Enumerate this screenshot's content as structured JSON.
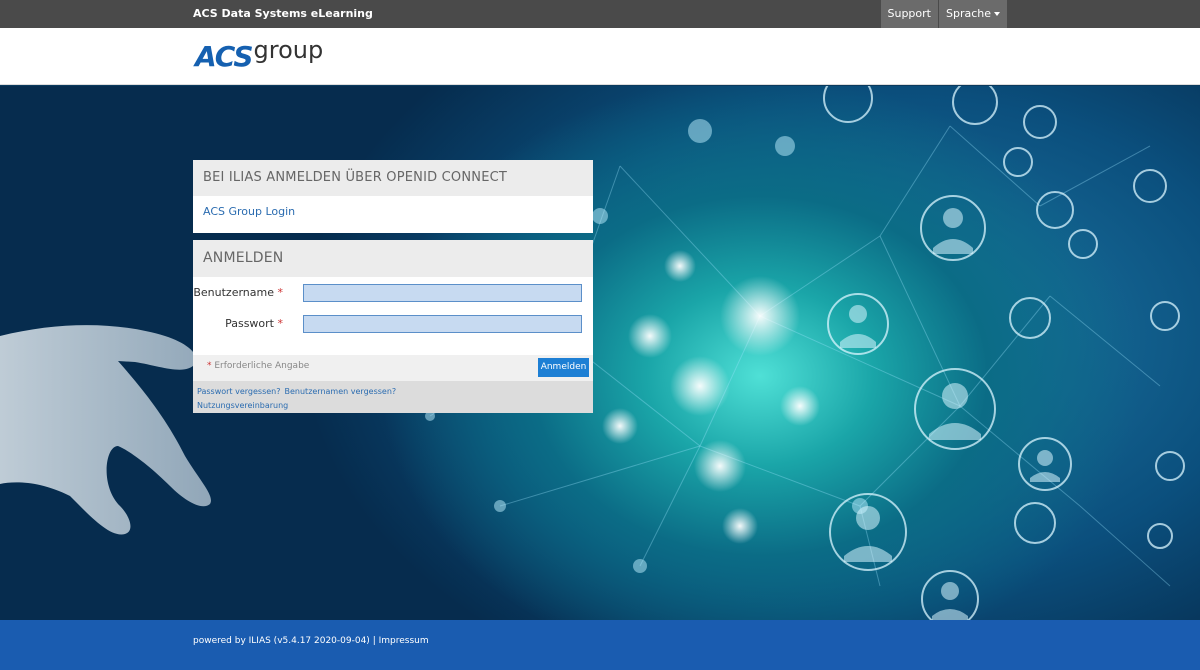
{
  "topbar": {
    "brand": "ACS Data Systems eLearning",
    "support": "Support",
    "language": "Sprache"
  },
  "logo": {
    "acs": "ACS",
    "group": "group"
  },
  "openid": {
    "heading": "BEI ILIAS ANMELDEN ÜBER OPENID CONNECT",
    "link": "ACS Group Login"
  },
  "login": {
    "heading": "ANMELDEN",
    "username_label": "Benutzername",
    "password_label": "Passwort",
    "required_mark": "*",
    "required_note": "Erforderliche Angabe",
    "submit": "Anmelden",
    "forgot_password": "Passwort vergessen?",
    "forgot_username": "Benutzernamen vergessen?",
    "terms": "Nutzungsvereinbarung"
  },
  "footer": {
    "powered": "powered by ILIAS (v5.4.17 2020-09-04)",
    "separator": "|",
    "imprint": "Impressum"
  },
  "colors": {
    "topbar": "#4a4a4a",
    "accent": "#1560b0",
    "button": "#1d7fd4",
    "footer": "#1a5cb0"
  }
}
